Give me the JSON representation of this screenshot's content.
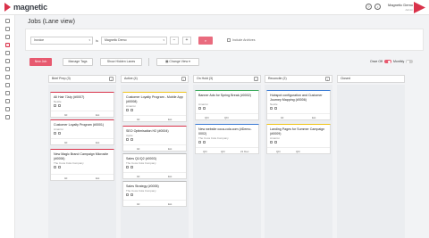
{
  "app": {
    "name": "magnetic"
  },
  "user": {
    "name": "Magnetic Demo",
    "role": "Admin"
  },
  "header_icons": [
    "help-icon",
    "bell-icon"
  ],
  "sidebar_icons": [
    "dashboard-icon",
    "user-icon",
    "dollar-icon",
    "home-icon",
    "list-icon",
    "clock-icon",
    "folder-icon",
    "calendar-icon",
    "check-icon",
    "settings-icon",
    "people-icon",
    "report-icon",
    "chart-icon"
  ],
  "page_title": "Jobs (Lane view)",
  "filters": {
    "field_value": "Invoice",
    "operator_label": "is",
    "value_value": "Magnetic Demo",
    "minus_label": "−",
    "plus_label": "+",
    "search_icon": "search-icon",
    "include_archives_label": "Include Archives"
  },
  "toolbar": {
    "new_job_label": "New Job",
    "manage_tags_label": "Manage Tags",
    "show_hidden_lanes_label": "Show Hidden Lanes",
    "change_view_label": "Change View",
    "once_off_label": "Once Off",
    "monthly_label": "Monthly"
  },
  "lanes": [
    {
      "title": "Brief Prep",
      "count": "3"
    },
    {
      "title": "Active",
      "count": "4"
    },
    {
      "title": "On Hold",
      "count": "3"
    },
    {
      "title": "Reconcile",
      "count": "2"
    },
    {
      "title": "Closed",
      "count": ""
    }
  ],
  "cards": {
    "c1": {
      "title": "All Hair 7July (#0007)",
      "client": "Nestle",
      "f1": "0d",
      "f2": "Est"
    },
    "c2": {
      "title": "Customer Loyalty Program (#0001)",
      "client": "Amazon",
      "f1": "0d",
      "f2": "Est"
    },
    "c3": {
      "title": "New Magic Brand Campaign Microsite (#0006)",
      "client": "The Coca Cola Company",
      "f1": "0d",
      "f2": "Est"
    },
    "c4": {
      "title": "Customer Loyalty Program - Mobile App (#0008)",
      "client": "Amazon",
      "f1": "0d",
      "f2": "Est"
    },
    "c5": {
      "title": "SEO Optimisation H2 (#0004)",
      "client": "Apple",
      "f1": "0d",
      "f2": "Est"
    },
    "c6": {
      "title": "Sales Q1/Q2 (#0003)",
      "client": "The Coca Cola Company",
      "f1": "0d",
      "f2": "Est"
    },
    "c7": {
      "title": "Sales Strategy (#0005)",
      "client": "The Coca Cola Company",
      "f1": "0d",
      "f2": "Est"
    },
    "c8": {
      "title": "Banner Ads for Spring Break (#0002)",
      "client": "Amazon",
      "f1": "Qhr",
      "f2": "Qhr"
    },
    "c9": {
      "title": "New website coca-cola.com (#Demo-0002)",
      "client": "The Coca Cola Company",
      "f1": "Qhr",
      "f2": "Qhr",
      "f3": "21 Dec"
    },
    "c10": {
      "title": "Hubspot configuration and Customer Journey Mapping (#0006)",
      "client": "Nestle",
      "f1": "0d",
      "f2": "Est"
    },
    "c11": {
      "title": "Landing Pages for Summer Campaign (#0009)",
      "client": "Amazon",
      "f1": "Qhr",
      "f2": "Qhr"
    }
  }
}
